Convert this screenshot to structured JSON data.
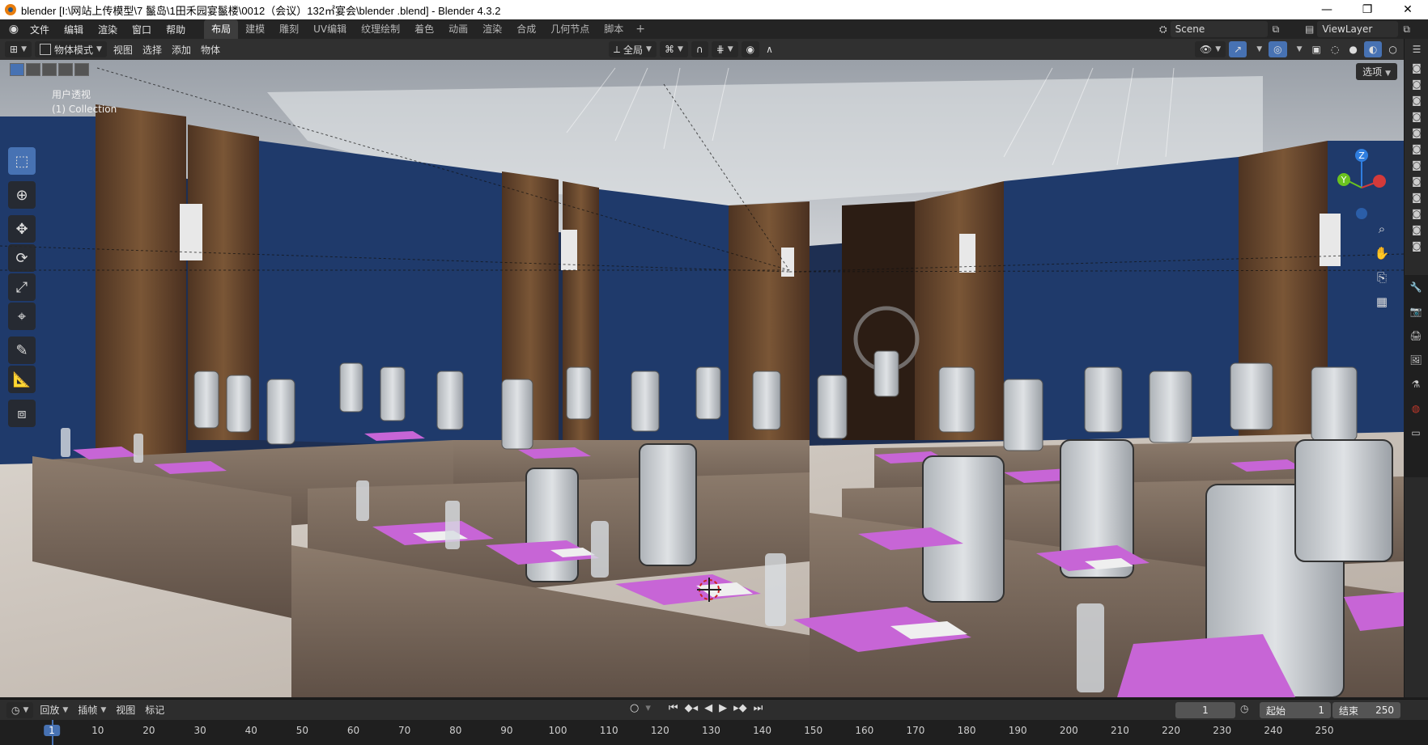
{
  "titlebar": {
    "title": "blender  [I:\\网站上传模型\\7 鬣岛\\1田禾园宴鬣楼\\0012（会议）132㎡宴会\\blender .blend] - Blender 4.3.2",
    "minimize": "—",
    "restore": "❐",
    "close": "✕"
  },
  "menubar": {
    "menus": [
      "文件",
      "编辑",
      "渲染",
      "窗口",
      "帮助"
    ],
    "workspaces": [
      "布局",
      "建模",
      "雕刻",
      "UV编辑",
      "纹理绘制",
      "着色",
      "动画",
      "渲染",
      "合成",
      "几何节点",
      "脚本"
    ],
    "active_workspace": "布局",
    "add_tab": "+",
    "scene": "Scene",
    "view_layer": "ViewLayer"
  },
  "viewport_header": {
    "editor_type": "⊞",
    "mode": "物体模式",
    "menus": [
      "视图",
      "选择",
      "添加",
      "物体"
    ],
    "transform_orientation": "全局",
    "options": "选项"
  },
  "viewport": {
    "view_name": "用户透视",
    "collection": "(1) Collection",
    "gizmo_axes": {
      "z": "Z",
      "y": "Y"
    }
  },
  "tools": [
    "select-box",
    "cursor",
    "move",
    "rotate",
    "scale",
    "transform",
    "annotate",
    "measure",
    "add-cube"
  ],
  "timeline": {
    "menus": [
      "回放",
      "插帧",
      "视图",
      "标记"
    ],
    "current_frame": "1",
    "start_label": "起始",
    "start_value": "1",
    "end_label": "结束",
    "end_value": "250",
    "ruler": [
      "1",
      "10",
      "20",
      "30",
      "40",
      "50",
      "60",
      "70",
      "80",
      "90",
      "100",
      "110",
      "120",
      "130",
      "140",
      "150",
      "160",
      "170",
      "180",
      "190",
      "200",
      "210",
      "220",
      "230",
      "240",
      "250"
    ]
  },
  "colors": {
    "accent": "#4772b3",
    "wall_blue": "#1f3a6b",
    "wood": "#6b4a2f",
    "tablecloth": "#7a6a5c",
    "notepad": "#c765d6",
    "chair": "#c8ccd0"
  }
}
